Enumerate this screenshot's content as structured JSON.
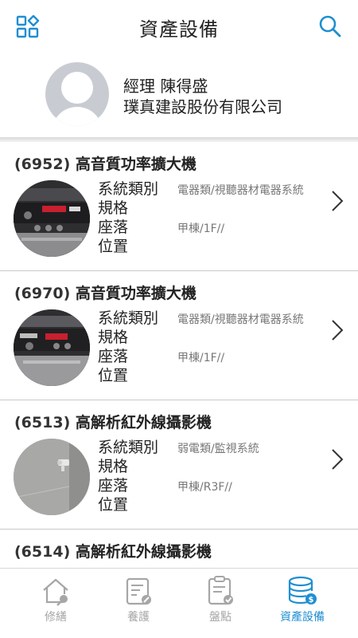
{
  "header": {
    "title": "資產設備",
    "menu_icon": "grid-icon",
    "search_icon": "search-icon",
    "accent_color": "#1f8fd1"
  },
  "profile": {
    "role_name": "經理 陳得盛",
    "company": "璞真建設股份有限公司"
  },
  "list": {
    "labels": {
      "type_line1": "系統類別",
      "type_line2": "規格",
      "loc_line1": "座落",
      "loc_line2": "位置"
    },
    "items": [
      {
        "code": "(6952)",
        "name": "高音質功率擴大機",
        "type": "電器類/視聽器材電器系統",
        "location": "甲棟/1F//"
      },
      {
        "code": "(6970)",
        "name": "高音質功率擴大機",
        "type": "電器類/視聽器材電器系統",
        "location": "甲棟/1F//"
      },
      {
        "code": "(6513)",
        "name": "高解析紅外線攝影機",
        "type": "弱電類/監視系統",
        "location": "甲棟/R3F//"
      },
      {
        "code": "(6514)",
        "name": "高解析紅外線攝影機",
        "type": "",
        "location": ""
      }
    ]
  },
  "tabbar": {
    "tabs": [
      {
        "label": "修繕",
        "icon": "house-wrench-icon",
        "active": false
      },
      {
        "label": "養護",
        "icon": "clipboard-wrench-icon",
        "active": false
      },
      {
        "label": "盤點",
        "icon": "clipboard-check-icon",
        "active": false
      },
      {
        "label": "資產設備",
        "icon": "database-coin-icon",
        "active": true
      }
    ]
  }
}
